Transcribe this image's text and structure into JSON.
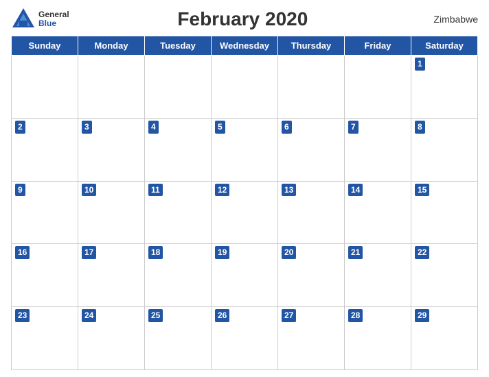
{
  "header": {
    "logo": {
      "general": "General",
      "blue": "Blue"
    },
    "title": "February 2020",
    "country": "Zimbabwe"
  },
  "weekdays": [
    "Sunday",
    "Monday",
    "Tuesday",
    "Wednesday",
    "Thursday",
    "Friday",
    "Saturday"
  ],
  "weeks": [
    [
      null,
      null,
      null,
      null,
      null,
      null,
      1
    ],
    [
      2,
      3,
      4,
      5,
      6,
      7,
      8
    ],
    [
      9,
      10,
      11,
      12,
      13,
      14,
      15
    ],
    [
      16,
      17,
      18,
      19,
      20,
      21,
      22
    ],
    [
      23,
      24,
      25,
      26,
      27,
      28,
      29
    ]
  ],
  "colors": {
    "header_bg": "#2255a4",
    "header_text": "#ffffff",
    "logo_blue": "#2255a4"
  }
}
